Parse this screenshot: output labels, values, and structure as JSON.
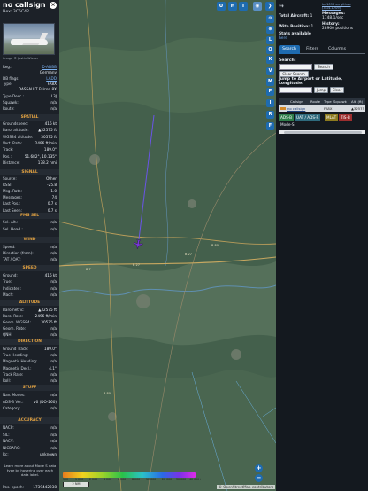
{
  "info": {
    "callsign": "no callsign",
    "hex": "Hex: 3C5C42",
    "photo_credit": "image © Justin Wieser",
    "reg_label": "Reg.:",
    "reg": "D-ADBB",
    "country": "Germany",
    "db_flags_label": "DB flags:",
    "db_flags": "LADD",
    "type_label": "Type:",
    "type": "FA8X",
    "model": "DASSAULT Falcon 8X",
    "type_desc_label": "Type Desc.:",
    "type_desc": "L3J",
    "squawk_label": "Squawk:",
    "squawk": "n/a",
    "route_label": "Route:",
    "route": "n/a",
    "sections": {
      "spatial": "SPATIAL",
      "signal": "SIGNAL",
      "fms_sel": "FMS SEL",
      "wind": "WIND",
      "speed": "SPEED",
      "altitude": "ALTITUDE",
      "direction": "DIRECTION",
      "stuff": "STUFF",
      "accuracy": "ACCURACY"
    },
    "spatial": [
      {
        "k": "Groundspeed:",
        "v": "416 kt"
      },
      {
        "k": "Baro. altitude:",
        "v": "▲32575 ft"
      },
      {
        "k": "WGS84 altitude:",
        "v": "30575 ft"
      },
      {
        "k": "Vert. Rate:",
        "v": "2496 ft/min"
      },
      {
        "k": "Track:",
        "v": "189.0°"
      },
      {
        "k": "Pos.:",
        "v": "51.682°, 10.135°"
      },
      {
        "k": "Distance:",
        "v": "178.2 nmi"
      }
    ],
    "signal": [
      {
        "k": "Source:",
        "v": "Other"
      },
      {
        "k": "RSSI:",
        "v": "-25.8"
      },
      {
        "k": "Msg. Rate:",
        "v": "1.0"
      },
      {
        "k": "Messages:",
        "v": "74"
      },
      {
        "k": "Last Pos.:",
        "v": "0.7 s"
      },
      {
        "k": "Last Seen:",
        "v": "0.7 s"
      }
    ],
    "fms": [
      {
        "k": "Sel. Alt.:",
        "v": "n/a"
      },
      {
        "k": "Sel. Head.:",
        "v": "n/a"
      }
    ],
    "wind": [
      {
        "k": "Speed:",
        "v": "n/a"
      },
      {
        "k": "Direction (from):",
        "v": "n/a"
      },
      {
        "k": "TAT / OAT:",
        "v": "n/a"
      }
    ],
    "speed": [
      {
        "k": "Ground:",
        "v": "416 kt"
      },
      {
        "k": "True:",
        "v": "n/a"
      },
      {
        "k": "Indicated:",
        "v": "n/a"
      },
      {
        "k": "Mach:",
        "v": "n/a"
      }
    ],
    "altitude": [
      {
        "k": "Barometric:",
        "v": "▲32575 ft"
      },
      {
        "k": "Baro. Rate:",
        "v": "2496 ft/min"
      },
      {
        "k": "Geom. WGS84:",
        "v": "30575 ft"
      },
      {
        "k": "Geom. Rate:",
        "v": "n/a"
      },
      {
        "k": "QNH:",
        "v": "n/a"
      }
    ],
    "direction": [
      {
        "k": "Ground Track:",
        "v": "189.0°"
      },
      {
        "k": "True Heading:",
        "v": "n/a"
      },
      {
        "k": "Magnetic Heading:",
        "v": "n/a"
      },
      {
        "k": "Magnetic Decl.:",
        "v": "4.1°"
      },
      {
        "k": "Track Rate:",
        "v": "n/a"
      },
      {
        "k": "Roll:",
        "v": "n/a"
      }
    ],
    "stuff": [
      {
        "k": "Nav. Modes:",
        "v": "n/a"
      },
      {
        "k": "ADS-B Ver.:",
        "v": "v0 (DO-260)"
      },
      {
        "k": "Category:",
        "v": "n/a"
      }
    ],
    "accuracy": [
      {
        "k": "NACP:",
        "v": "n/a"
      },
      {
        "k": "SIL:",
        "v": "n/a"
      },
      {
        "k": "NACV:",
        "v": "n/a"
      },
      {
        "k": "NICBARO:",
        "v": "n/a"
      },
      {
        "k": "Rc:",
        "v": "unknown"
      }
    ],
    "learn_more": "Learn more about Mode S data type by hovering over each data label.",
    "pos_epoch_label": "Pos. epoch:",
    "pos_epoch": "1739442238"
  },
  "map": {
    "top_buttons": [
      "U",
      "H",
      "T"
    ],
    "side_buttons": [
      "L",
      "O",
      "K",
      "V",
      "M",
      "P",
      "I",
      "R",
      "F"
    ],
    "zoom_in": "+",
    "zoom_out": "−",
    "scale": "2 NM",
    "alt_labels": [
      "500",
      "1 000",
      "2 000",
      "4 000",
      "6 000",
      "8 000",
      "10 000",
      "20 000",
      "30 000",
      "40 000+"
    ],
    "attribution": "© OpenStreetMap contributors",
    "road_labels": [
      "B 7",
      "B 27",
      "B 27",
      "B 80",
      "B 80"
    ]
  },
  "sidebar": {
    "version": "tar1090 on github (3.14.1709)",
    "total_aircraft_label": "Total Aircraft:",
    "total_aircraft": "1",
    "messages_label": "Messages:",
    "messages": "1748.1/sec",
    "with_position_label": "With Position:",
    "with_position": "1",
    "history_label": "History:",
    "history": "28900 positions",
    "stats_label": "Stats available",
    "stats_link": "here",
    "tabs": [
      "Search",
      "Filters",
      "Columns"
    ],
    "search_label": "Search:",
    "search_button": "Search",
    "clear_search_button": "Clear Search",
    "jump_label": "Jump to Airport or Latitude, Longitude:",
    "jump_button": "Jump",
    "clear_button": "Clear",
    "columns": [
      "Callsign",
      "Route",
      "Type",
      "Squawk",
      "Alt. (ft)"
    ],
    "row": {
      "callsign": "no callsign",
      "route": "",
      "type": "FA8X",
      "squawk": "",
      "alt": "▲32575"
    },
    "chips": [
      {
        "label": "ADS-B",
        "color": "#2e7d4a"
      },
      {
        "label": "UAT / ADS-R",
        "color": "#2e6a7d"
      },
      {
        "label": "MLAT",
        "color": "#8c7a1e"
      },
      {
        "label": "TIS-B",
        "color": "#9c2e2e"
      }
    ],
    "mode_s": "Mode-S"
  },
  "colors": {
    "accent": "#1e6bb0",
    "section": "#e0a040",
    "track": "#6a54e8",
    "aircraft": "#7a3ad8"
  }
}
